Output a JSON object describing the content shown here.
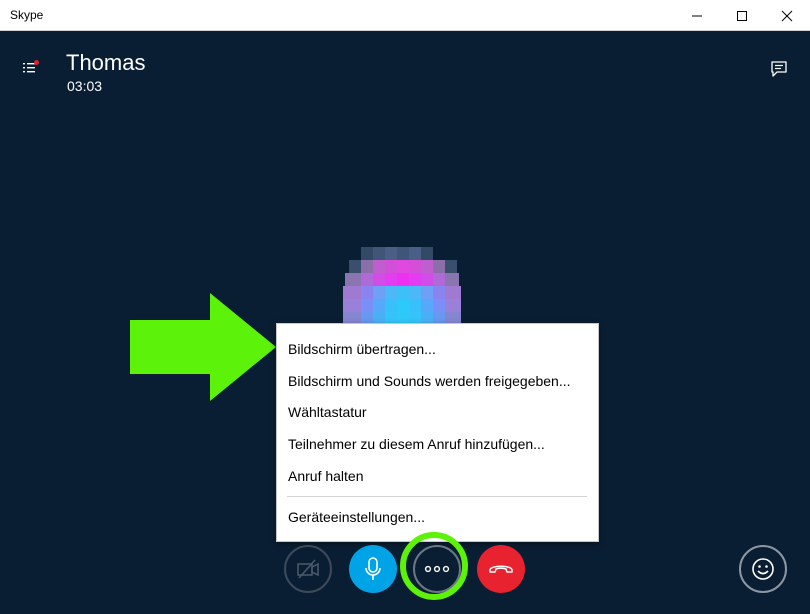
{
  "window": {
    "title": "Skype",
    "controls": [
      "minimize-icon",
      "maximize-icon",
      "close-icon"
    ]
  },
  "call": {
    "contact_name": "Thomas",
    "duration": "03:03",
    "icons": [
      "list-icon",
      "chat-icon"
    ]
  },
  "context_menu": {
    "items": [
      "Bildschirm übertragen...",
      "Bildschirm und Sounds werden freigegeben...",
      "Wähltastatur",
      "Teilnehmer zu diesem Anruf hinzufügen...",
      "Anruf halten",
      "Geräteeinstellungen..."
    ]
  },
  "controls": {
    "buttons": [
      "video-off-icon",
      "microphone-icon",
      "more-icon",
      "hang-up-icon",
      "emoji-icon"
    ]
  },
  "colors": {
    "call_background": "#0a1e33",
    "mic_button": "#00a3e6",
    "end_call_button": "#e8222e",
    "highlight_green": "#5cf20a"
  }
}
